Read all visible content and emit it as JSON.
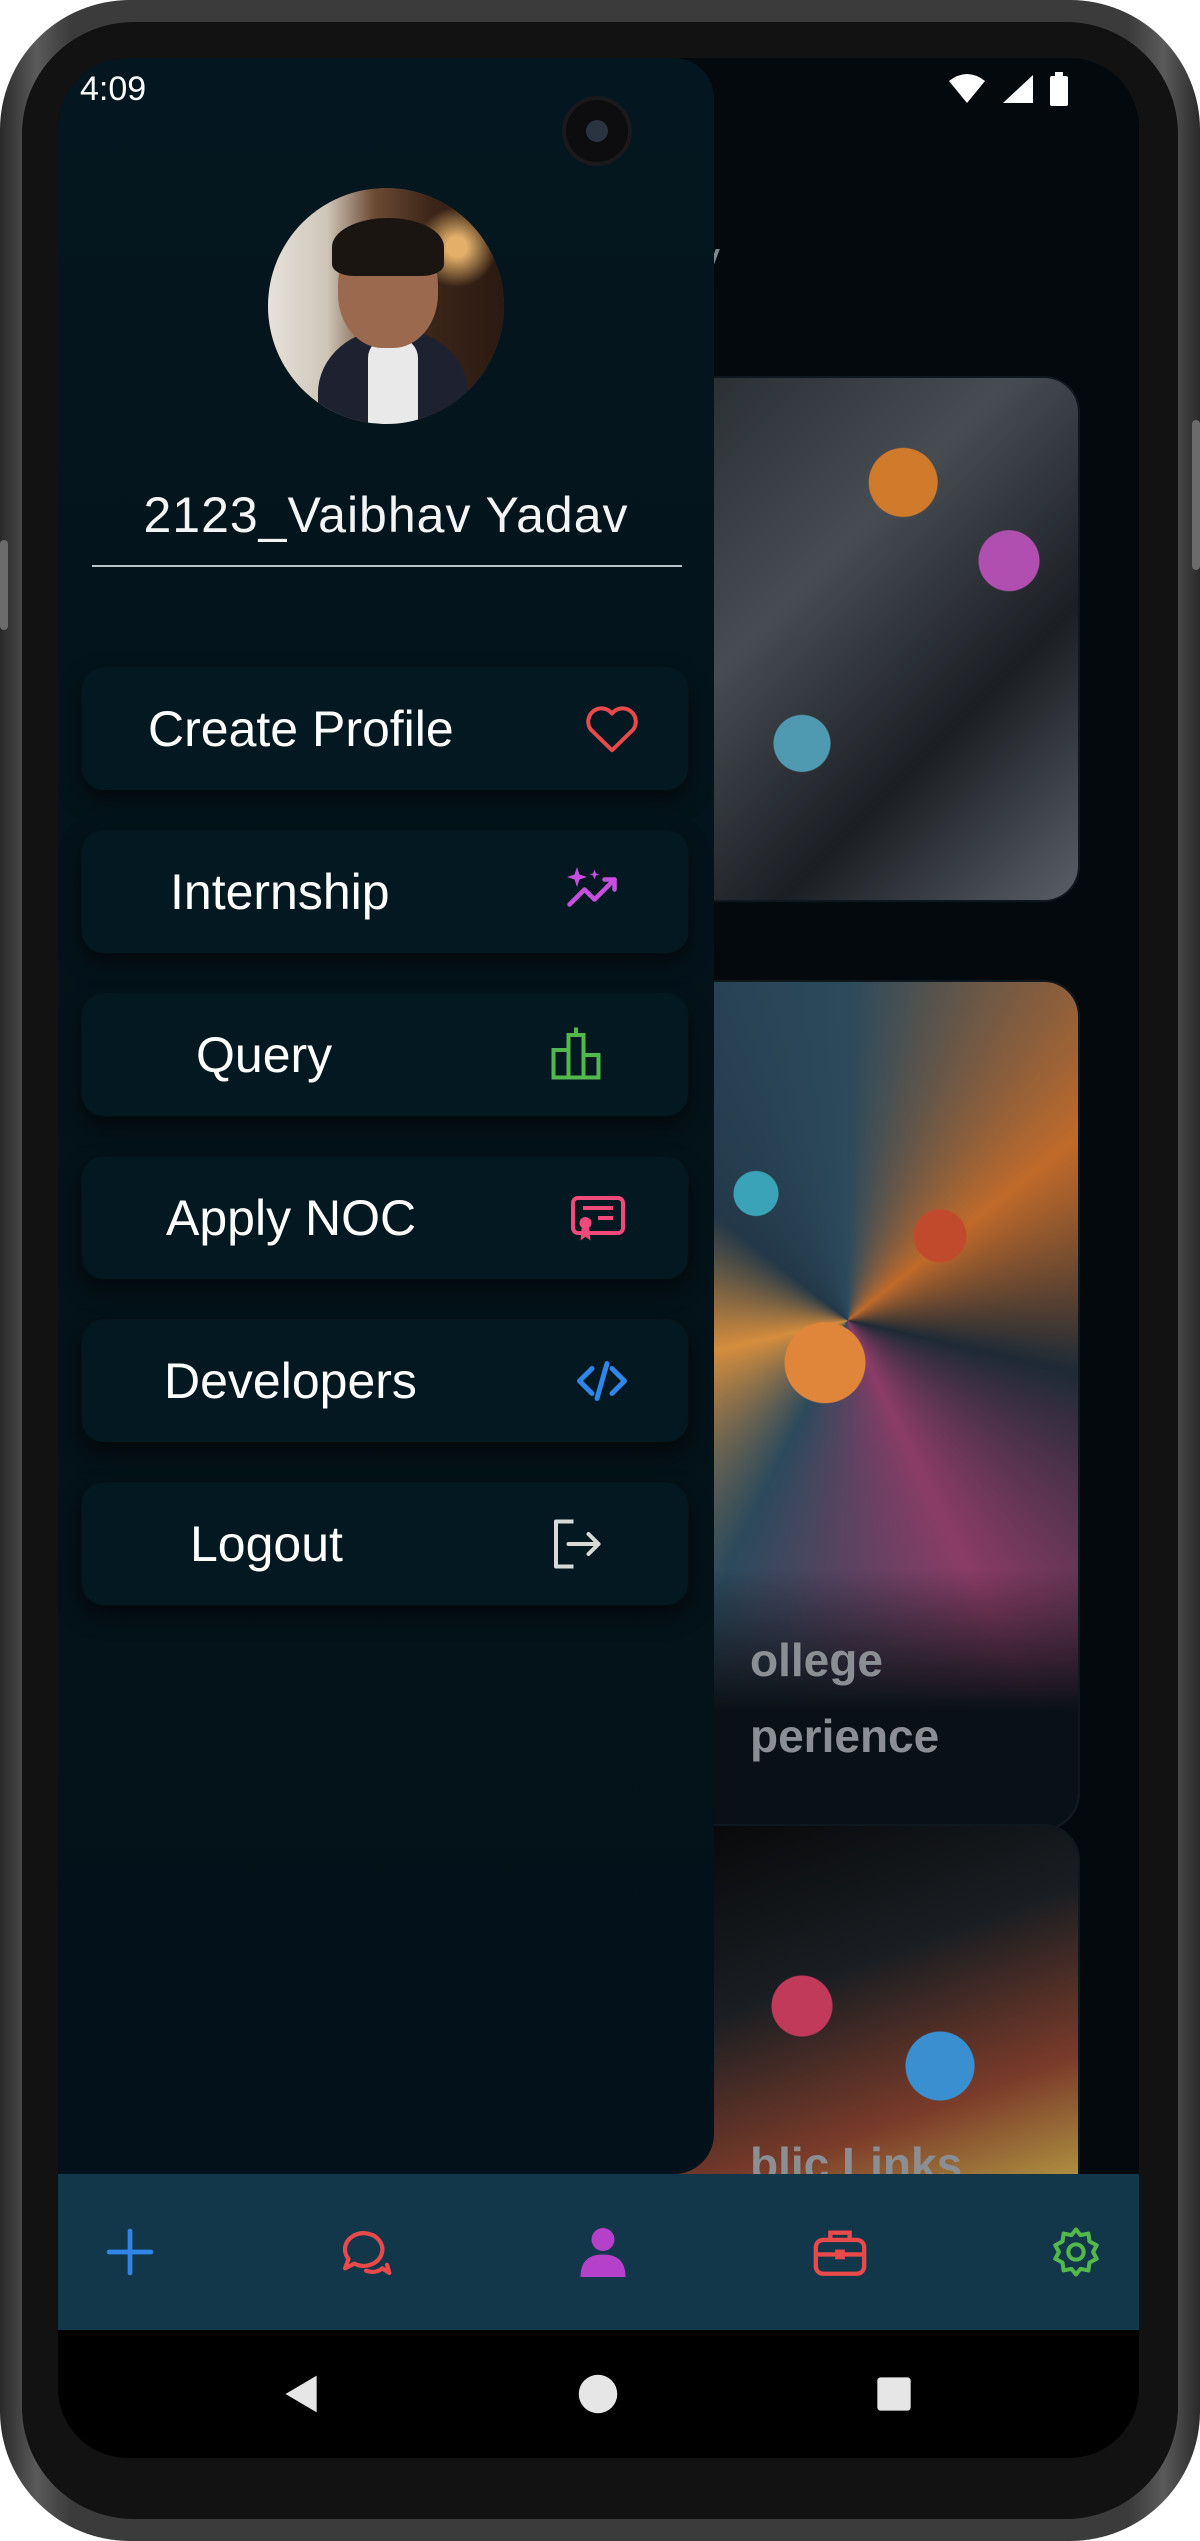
{
  "status_bar": {
    "time": "4:09",
    "icons": [
      "wifi-icon",
      "signal-icon",
      "battery-icon"
    ]
  },
  "background": {
    "heading_fragment": "v",
    "cards": [
      {
        "title": ""
      },
      {
        "title": "ollege\nperience"
      },
      {
        "title": "blic Links"
      }
    ]
  },
  "drawer": {
    "user_name": "2123_Vaibhav Yadav",
    "menu": [
      {
        "label": "Create Profile",
        "icon": "heart-icon",
        "color": "#e8494a"
      },
      {
        "label": "Internship",
        "icon": "sparkles-trend-icon",
        "color": "#c64fe0"
      },
      {
        "label": "Query",
        "icon": "buildings-icon",
        "color": "#52b84c"
      },
      {
        "label": "Apply NOC",
        "icon": "certificate-icon",
        "color": "#f04a7a"
      },
      {
        "label": "Developers",
        "icon": "code-icon",
        "color": "#2f86e8"
      },
      {
        "label": "Logout",
        "icon": "logout-icon",
        "color": "#d9d9d9"
      }
    ]
  },
  "bottom_bar": {
    "background": "#12364a",
    "items": [
      {
        "icon": "add-icon",
        "color": "#2f86e8"
      },
      {
        "icon": "chat-icon",
        "color": "#e8494a"
      },
      {
        "icon": "profile-icon",
        "color": "#b540c9"
      },
      {
        "icon": "briefcase-icon",
        "color": "#e8494a"
      },
      {
        "icon": "settings-icon",
        "color": "#52b84c"
      }
    ]
  },
  "nav_bar": {
    "items": [
      "back-icon",
      "home-icon",
      "recents-icon"
    ]
  }
}
